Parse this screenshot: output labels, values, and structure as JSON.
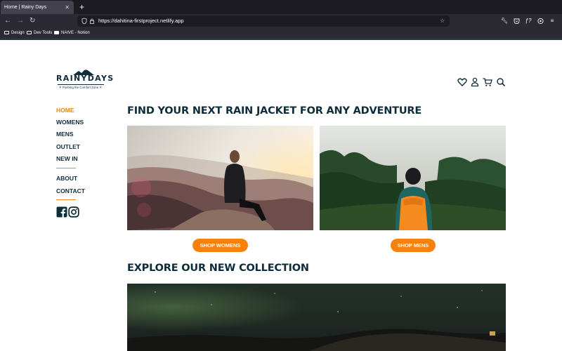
{
  "browser": {
    "tab_title": "Home | Rainy Days",
    "url": "https://dahitina-firstproject.netlify.app",
    "bookmarks": [
      {
        "label": "Design"
      },
      {
        "label": "Dev Tools"
      },
      {
        "label": "NAIVE - Notion"
      }
    ]
  },
  "site": {
    "logo_text": "RAINYDAYS",
    "tagline": "✕ Pushing the Comfort Zone ✕",
    "nav": [
      {
        "label": "HOME"
      },
      {
        "label": "WOMENS"
      },
      {
        "label": "MENS"
      },
      {
        "label": "OUTLET"
      },
      {
        "label": "NEW IN"
      },
      {
        "label": "ABOUT"
      },
      {
        "label": "CONTACT"
      }
    ],
    "heading": "FIND YOUR NEXT RAIN JACKET FOR ANY ADVENTURE",
    "shop_women": "SHOP WOMENS",
    "shop_men": "SHOP MENS",
    "collection_heading": "EXPLORE OUR NEW COLLECTION"
  },
  "icons": {
    "header": [
      "heart-icon",
      "user-icon",
      "cart-icon",
      "search-icon"
    ],
    "social": [
      "facebook-icon",
      "instagram-icon"
    ]
  },
  "colors": {
    "accent": "#f7810a",
    "navy": "#0f2c3a",
    "chrome_dark": "#1c1b22",
    "chrome": "#2b2a33"
  }
}
